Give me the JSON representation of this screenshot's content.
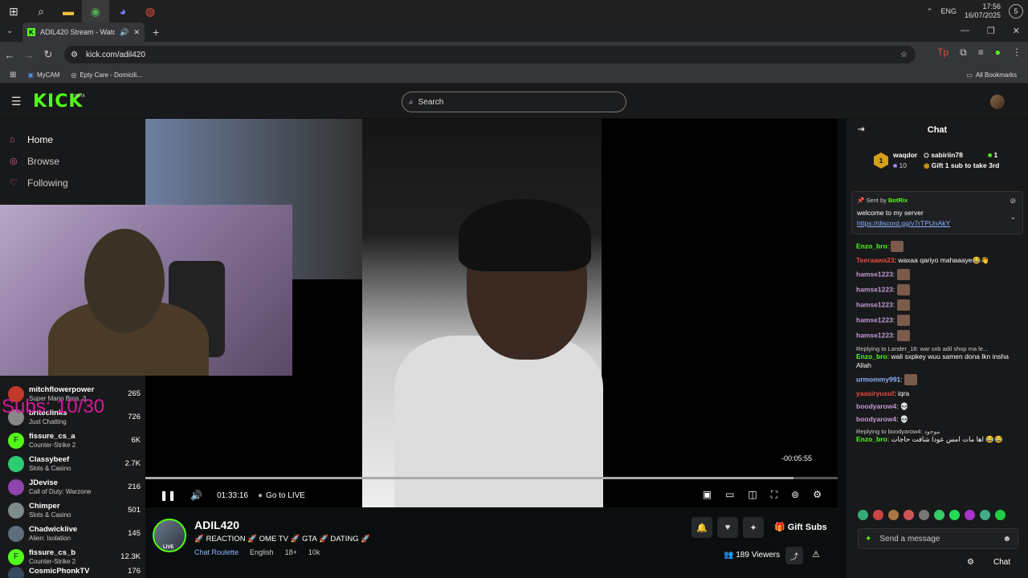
{
  "taskbar": {
    "lang": "ENG",
    "time": "17:56",
    "date": "16/07/2025",
    "notif_count": "5"
  },
  "browser": {
    "tab_title": "ADIL420 Stream - Watch Li",
    "url": "kick.com/adil420",
    "bookmarks": [
      {
        "label": "MyCAM"
      },
      {
        "label": "Epty Care - Domicili..."
      }
    ],
    "all_bookmarks": "All Bookmarks"
  },
  "header": {
    "logo": "KICK",
    "beta": "BETA",
    "search_placeholder": "Search"
  },
  "sidebar": {
    "nav": [
      {
        "label": "Home"
      },
      {
        "label": "Browse"
      },
      {
        "label": "Following"
      }
    ],
    "channels": [
      {
        "name": "mitchflowerpower",
        "game": "Super Mario Bros. 3",
        "viewers": "265",
        "avatar_color": "#c0392b"
      },
      {
        "name": "briteclinks",
        "game": "Just Chatting",
        "viewers": "726",
        "avatar_color": "#888888"
      },
      {
        "name": "fissure_cs_a",
        "game": "Counter-Strike 2",
        "viewers": "6K",
        "avatar_color": "#53fc18"
      },
      {
        "name": "Classybeef",
        "game": "Slots & Casino",
        "viewers": "2.7K",
        "avatar_color": "#2ecc71"
      },
      {
        "name": "JDevise",
        "game": "Call of Duty: Warzone",
        "viewers": "216",
        "avatar_color": "#8e44ad"
      },
      {
        "name": "Chimper",
        "game": "Slots & Casino",
        "viewers": "501",
        "avatar_color": "#7f8c8d"
      },
      {
        "name": "Chadwicklive",
        "game": "Alien: Isolation",
        "viewers": "145",
        "avatar_color": "#5d6d7e"
      },
      {
        "name": "fissure_cs_b",
        "game": "Counter-Strike 2",
        "viewers": "12.3K",
        "avatar_color": "#53fc18"
      },
      {
        "name": "CosmicPhonkTV",
        "game": "",
        "viewers": "176",
        "avatar_color": "#34495e"
      }
    ]
  },
  "overlay": {
    "subs": "Subs: 10/30"
  },
  "player": {
    "remaining": "-00:05:55",
    "elapsed": "01:33:16",
    "go_live": "Go to LIVE",
    "progress": 0.936
  },
  "stream": {
    "name": "ADIL420",
    "title": "🚀 REACTION 🚀 OME TV 🚀 GTA 🚀 DATING 🚀",
    "category": "Chat Roulette",
    "language": "English",
    "age": "18+",
    "followers": "10k",
    "live": "LIVE",
    "gift_subs": "Gift Subs",
    "viewers": "189 Viewers"
  },
  "chat": {
    "title": "Chat",
    "leader": {
      "rank": "1",
      "name": "waqdor",
      "count": "10",
      "gifter": "sabiriin78",
      "gift_count": "1",
      "cta": "Gift 1 sub to take 3rd"
    },
    "pinned": {
      "sent_by": "Sent by",
      "bot": "BotRix",
      "text": "welcome to my server",
      "link": "https://discord.gg/v7rTPUnAkY"
    },
    "messages": [
      {
        "user": "Enzo_bro",
        "color": "#53fc18",
        "text": "",
        "emote": true
      },
      {
        "user": "Teeraawa23",
        "color": "#e74c3c",
        "text": "waxaa qariyo mahaaaye😂👋",
        "emote": false
      },
      {
        "user": "hamse1223",
        "color": "#c39bd3",
        "text": "",
        "emote": true
      },
      {
        "user": "hamse1223",
        "color": "#c39bd3",
        "text": "",
        "emote": true
      },
      {
        "user": "hamse1223",
        "color": "#c39bd3",
        "text": "",
        "emote": true
      },
      {
        "user": "hamse1223",
        "color": "#c39bd3",
        "text": "",
        "emote": true
      },
      {
        "user": "hamse1223",
        "color": "#c39bd3",
        "text": "",
        "emote": true
      }
    ],
    "reply1": "Replying to Lander_18: war sxb adil shop ma le...",
    "msg_enzo2": {
      "user": "Enzo_bro",
      "text": "wali sxpkey wuu samen dona lkn insha Allah"
    },
    "msg_urm": {
      "user": "urmommy991",
      "text": ""
    },
    "msg_yaa": {
      "user": "yaasiryusuf",
      "text": "iqra"
    },
    "msg_boody1": {
      "user": "boodyarow4",
      "text": "💀"
    },
    "msg_boody2": {
      "user": "boodyarow4",
      "text": "💀"
    },
    "reply2": "Replying to boodyarow4: موجود",
    "msg_enzo3": {
      "user": "Enzo_bro",
      "text": "اها مات امس عودا شافت حاجات 😂😂"
    },
    "input_placeholder": "Send a message",
    "bottom_chat": "Chat"
  }
}
